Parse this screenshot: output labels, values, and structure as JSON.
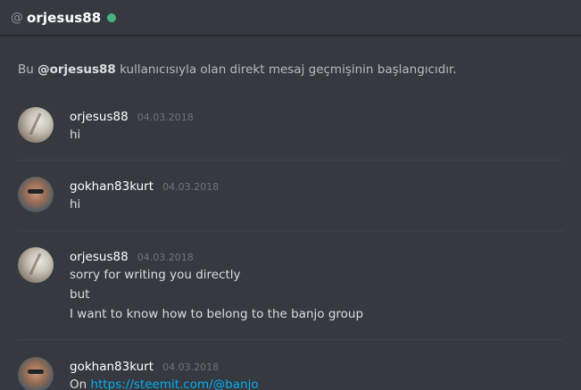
{
  "header": {
    "at_symbol": "@",
    "username": "orjesus88",
    "status": "online",
    "status_color": "#43b581"
  },
  "intro": {
    "prefix": "Bu",
    "mention": "@orjesus88",
    "suffix": "kullanıcısıyla olan direkt mesaj geçmişinin başlangıcıdır."
  },
  "messages": [
    {
      "author": "orjesus88",
      "timestamp": "04.03.2018",
      "avatar": "orjesus88-avatar",
      "lines": [
        "hi"
      ]
    },
    {
      "author": "gokhan83kurt",
      "timestamp": "04.03.2018",
      "avatar": "gokhan83kurt-avatar",
      "lines": [
        "hi"
      ]
    },
    {
      "author": "orjesus88",
      "timestamp": "04.03.2018",
      "avatar": "orjesus88-avatar",
      "lines": [
        "sorry for writing you directly",
        "but",
        "I want to know how to belong to the banjo group"
      ]
    },
    {
      "author": "gokhan83kurt",
      "timestamp": "04.03.2018",
      "avatar": "gokhan83kurt-avatar",
      "lines": [
        "On"
      ],
      "link": "https://steemit.com/@banjo"
    }
  ],
  "colors": {
    "background": "#36393f",
    "link": "#00b0f4",
    "online": "#43b581"
  }
}
